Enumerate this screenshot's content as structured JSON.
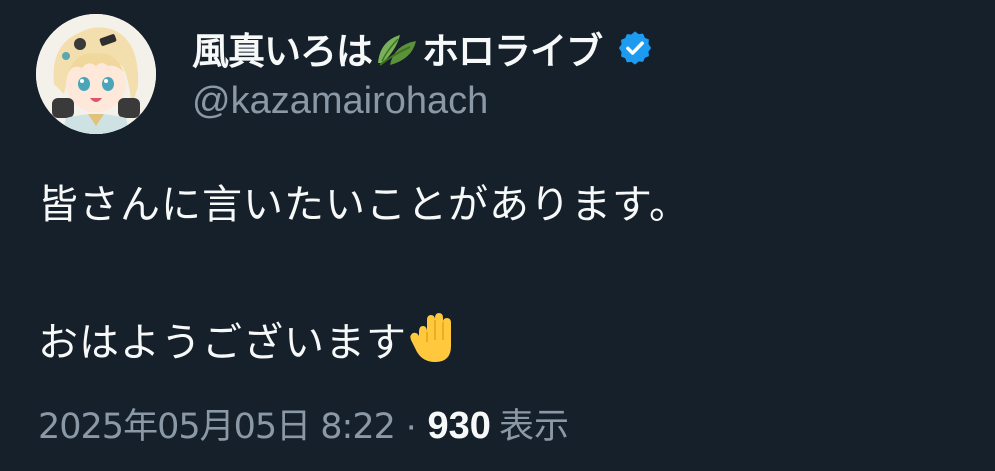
{
  "tweet": {
    "display_name": "風真いろは",
    "display_name_suffix": "ホロライブ",
    "handle": "@kazamairohach",
    "text_line1": "皆さんに言いたいことがあります。",
    "text_line2": "おはようございます",
    "timestamp": "2025年05月05日 8:22",
    "separator": "·",
    "views_count": "930",
    "views_label": "表示"
  },
  "icons": {
    "leaf": "leaf-emoji-icon",
    "verified": "verified-badge-icon",
    "hand": "raised-hand-emoji-icon"
  },
  "colors": {
    "background": "#15202b",
    "primary_text": "#f7f9f9",
    "secondary_text": "#8b98a5",
    "verified_blue": "#1d9bf0"
  }
}
